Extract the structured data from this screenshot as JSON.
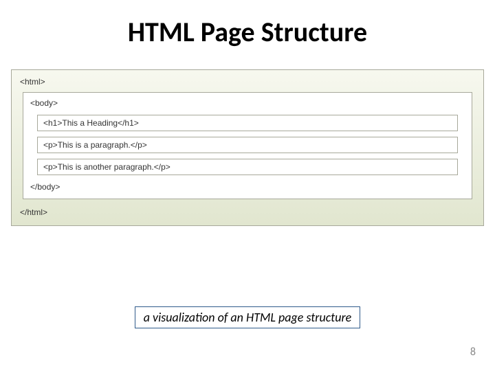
{
  "title": "HTML Page Structure",
  "diagram": {
    "html_open": "<html>",
    "html_close": "</html>",
    "body_open": "<body>",
    "body_close": "</body>",
    "h1": "<h1>This a Heading</h1>",
    "p1": "<p>This is a paragraph.</p>",
    "p2": "<p>This is another paragraph.</p>"
  },
  "caption": "a visualization of an HTML page structure",
  "page_number": "8"
}
